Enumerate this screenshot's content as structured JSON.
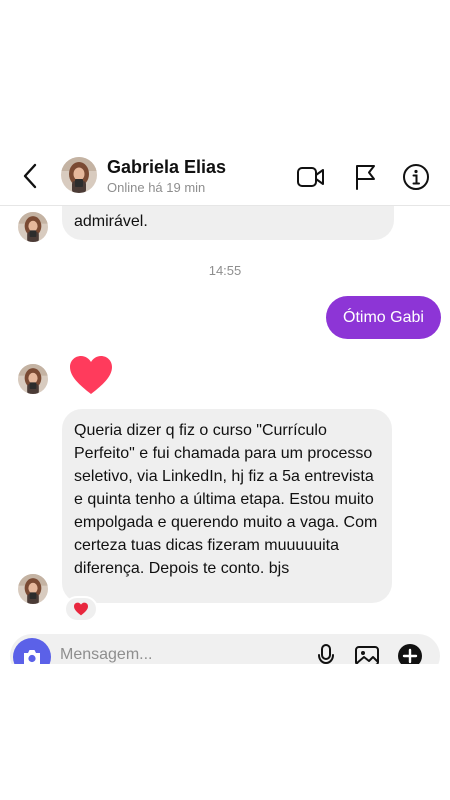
{
  "header": {
    "name": "Gabriela Elias",
    "status": "Online há 19 min"
  },
  "messages": {
    "first_tail": "admirável.",
    "timestamp": "14:55",
    "outgoing": "Ótimo Gabi",
    "long_message": "Queria dizer q fiz o curso \"Currículo Perfeito\" e fui chamada para um processo seletivo, via LinkedIn, hj fiz a 5a entrevista e quinta tenho a última etapa. Estou muito empolgada e querendo muito a vaga. Com certeza tuas dicas fizeram muuuuuita diferença. Depois te conto. bjs"
  },
  "composer": {
    "placeholder": "Mensagem..."
  },
  "colors": {
    "outgoing_bubble": "#8d35d6",
    "incoming_bubble": "#efefef",
    "heart": "#ff3b5c",
    "camera_button": "#5b61e8"
  },
  "icons": {
    "back": "chevron-left-icon",
    "video": "video-camera-icon",
    "flag": "flag-icon",
    "info": "info-icon",
    "heart": "heart-icon",
    "camera": "camera-icon",
    "mic": "microphone-icon",
    "gallery": "gallery-icon",
    "plus": "plus-icon"
  }
}
